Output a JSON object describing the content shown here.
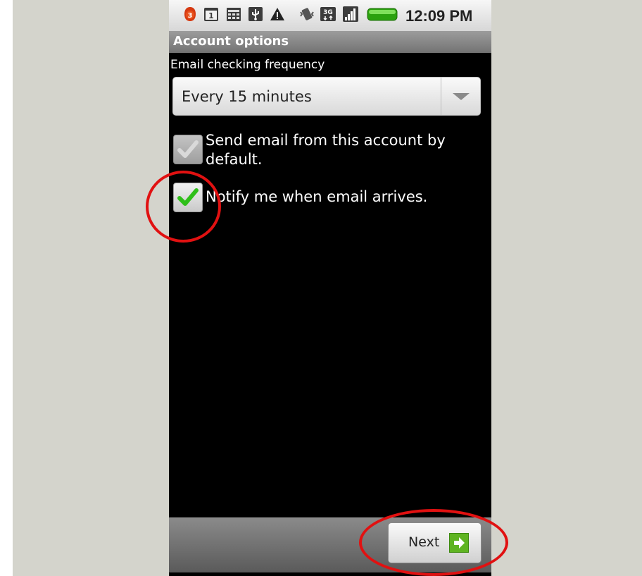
{
  "status_bar": {
    "notification_badge": "3",
    "calendar_day": "1",
    "time": "12:09 PM",
    "network_type": "3G",
    "icons": [
      "notification-badge-icon",
      "calendar-icon",
      "keyboard-icon",
      "usb-icon",
      "warning-icon",
      "vibrate-icon",
      "network-3g-icon",
      "signal-icon",
      "battery-icon"
    ]
  },
  "header": {
    "title": "Account options"
  },
  "form": {
    "frequency_label": "Email checking frequency",
    "frequency_value": "Every 15 minutes",
    "checkboxes": [
      {
        "label": "Send email from this account by default.",
        "checked": true,
        "enabled": false
      },
      {
        "label": "Notify me when email arrives.",
        "checked": true,
        "enabled": true
      }
    ]
  },
  "footer": {
    "next_label": "Next"
  },
  "colors": {
    "annotation": "#e11111",
    "check_green": "#2fbf1a",
    "next_arrow": "#5fb422"
  }
}
